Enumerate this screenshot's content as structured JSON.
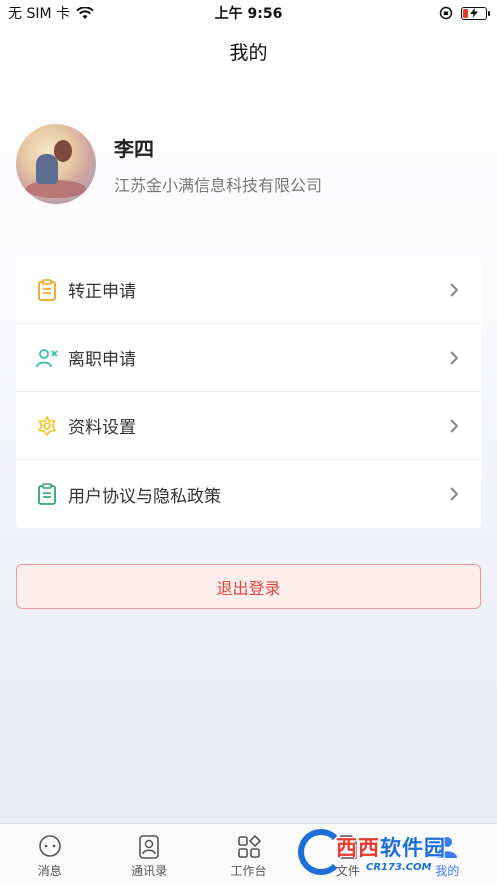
{
  "status_bar": {
    "carrier": "无 SIM 卡",
    "time": "上午 9:56",
    "battery_level": 0.25
  },
  "nav": {
    "title": "我的"
  },
  "profile": {
    "name": "李四",
    "company": "江苏金小满信息科技有限公司"
  },
  "menu": {
    "items": [
      {
        "label": "转正申请",
        "icon": "clipboard-icon",
        "color": "#f0a21b"
      },
      {
        "label": "离职申请",
        "icon": "person-leave-icon",
        "color": "#2ec4a6"
      },
      {
        "label": "资料设置",
        "icon": "flower-settings-icon",
        "color": "#f0c61b"
      },
      {
        "label": "用户协议与隐私政策",
        "icon": "document-icon",
        "color": "#2fa66a"
      }
    ]
  },
  "logout": {
    "label": "退出登录"
  },
  "tabbar": {
    "tabs": [
      {
        "label": "消息",
        "icon": "chat-bubble-icon"
      },
      {
        "label": "通讯录",
        "icon": "contacts-icon"
      },
      {
        "label": "工作台",
        "icon": "grid-icon"
      },
      {
        "label": "文件",
        "icon": "file-icon"
      },
      {
        "label": "我的",
        "icon": "profile-icon",
        "active": true
      }
    ]
  },
  "watermark": {
    "main_red": "西西",
    "main_blue": "软件园",
    "sub": "CR173.COM"
  },
  "colors": {
    "accent": "#3b7cf5",
    "logout_text": "#e0463d",
    "logout_border": "#e89a9a"
  }
}
